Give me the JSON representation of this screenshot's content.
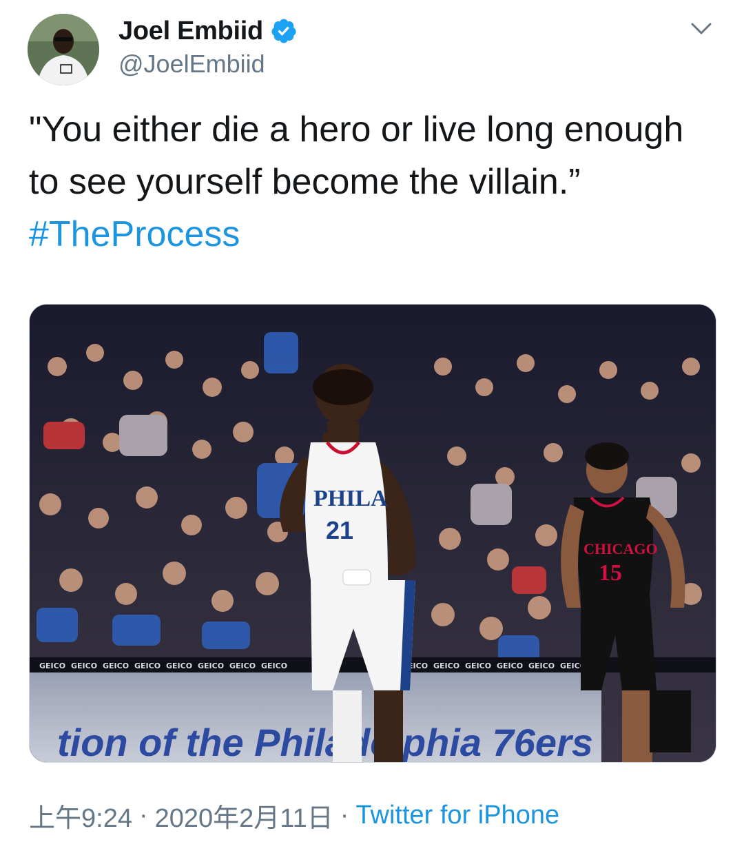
{
  "author": {
    "display_name": "Joel Embiid",
    "handle": "@JoelEmbiid",
    "verified": true,
    "avatar_icon": "profile-photo"
  },
  "tweet": {
    "text_main": "\"You either die a hero or live long enough to see yourself become the villain.”",
    "hashtag": "#TheProcess"
  },
  "media": {
    "type": "photo",
    "jersey_home_text": "PHILA",
    "jersey_home_number": "21",
    "jersey_away_text": "CHICAGO",
    "jersey_away_number": "15",
    "board_text": "tion of the Philadelphia 76ers",
    "ad_text": "GEICO"
  },
  "footer": {
    "time": "上午9:24",
    "date": "2020年2月11日",
    "separator": "·",
    "source": "Twitter for iPhone"
  },
  "colors": {
    "link": "#1b95e0",
    "secondary_text": "#657786",
    "verified_badge": "#1da1f2"
  },
  "icons": {
    "menu": "chevron-down-icon",
    "verified": "verified-badge-icon"
  }
}
